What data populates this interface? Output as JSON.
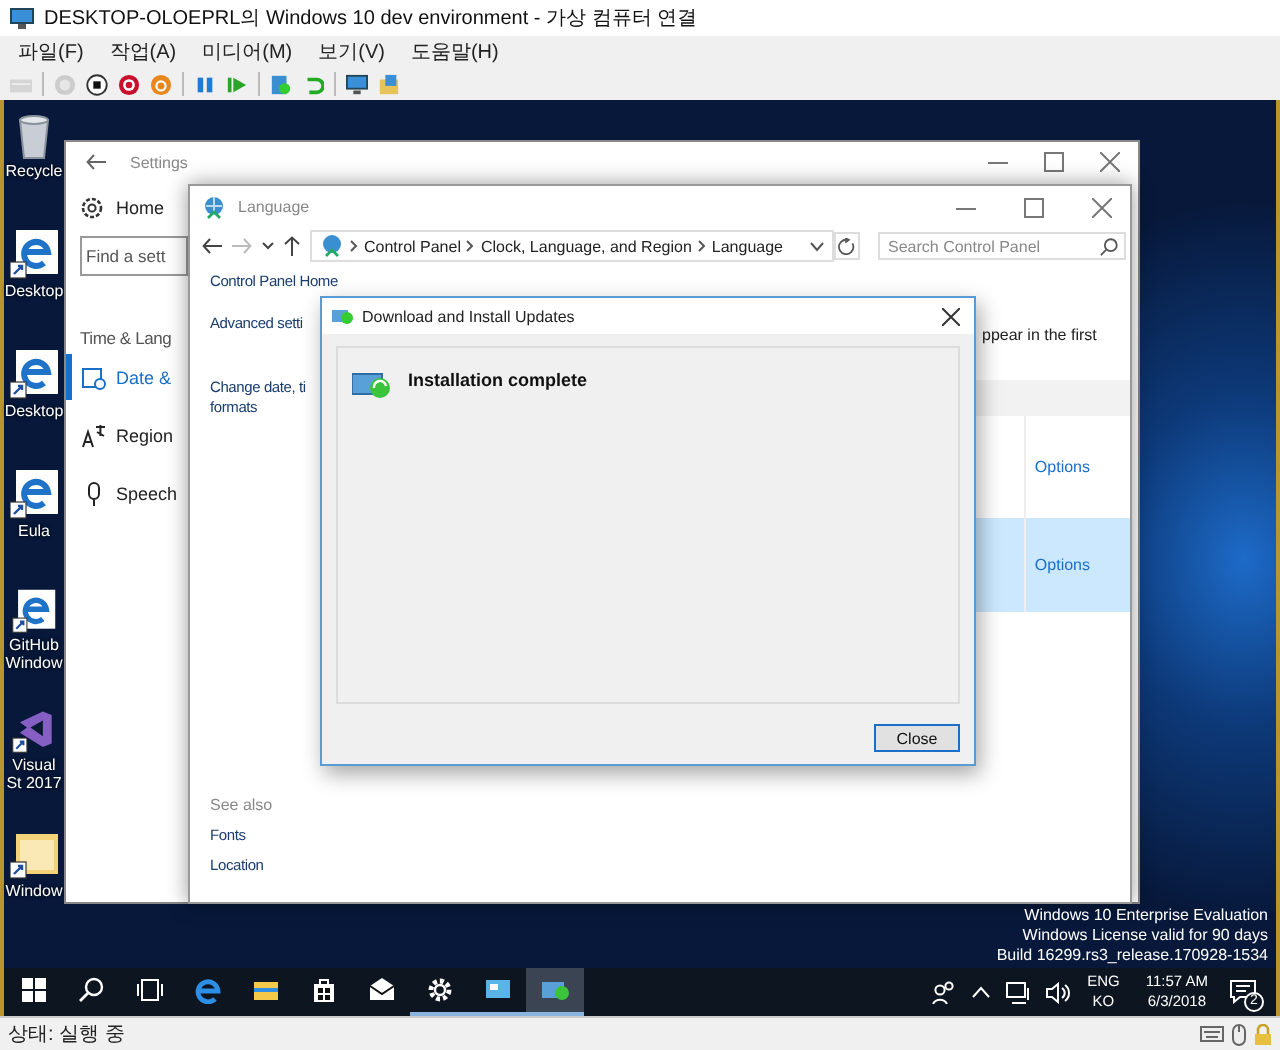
{
  "host_window": {
    "title": "DESKTOP-OLOEPRL의 Windows 10 dev environment - 가상 컴퓨터 연결",
    "menu": [
      "파일(F)",
      "작업(A)",
      "미디어(M)",
      "보기(V)",
      "도움말(H)"
    ],
    "toolbar_groups": [
      [
        {
          "kind": "ctrl-alt-del",
          "disabled": true
        }
      ],
      [
        {
          "kind": "start",
          "disabled": true
        },
        {
          "kind": "turn-off",
          "disabled": false
        },
        {
          "kind": "shut-down",
          "disabled": false
        },
        {
          "kind": "save",
          "disabled": false
        }
      ],
      [
        {
          "kind": "pause",
          "disabled": false
        },
        {
          "kind": "reset",
          "disabled": false
        }
      ],
      [
        {
          "kind": "checkpoint",
          "disabled": false
        },
        {
          "kind": "revert",
          "disabled": false
        }
      ],
      [
        {
          "kind": "session",
          "disabled": false
        },
        {
          "kind": "share",
          "disabled": false
        }
      ]
    ],
    "status": "상태: 실행 중"
  },
  "desktop_icons": [
    {
      "kind": "recycle",
      "label": "Recycle"
    },
    {
      "kind": "edge",
      "label": "Desktop"
    },
    {
      "kind": "edge",
      "label": "Desktop"
    },
    {
      "kind": "edge",
      "label": "Eula"
    },
    {
      "kind": "edge",
      "label": "GitHub Window"
    },
    {
      "kind": "vs",
      "label": "Visual St 2017"
    },
    {
      "kind": "folder",
      "label": "Window"
    }
  ],
  "settings_window": {
    "title": "Settings",
    "home": "Home",
    "search": {
      "placeholder": "Find a sett"
    },
    "section": "Time & Lang",
    "nav": [
      {
        "kind": "date",
        "label": "Date &",
        "selected": true
      },
      {
        "kind": "region",
        "label": "Region",
        "selected": false
      },
      {
        "kind": "speech",
        "label": "Speech",
        "selected": false
      }
    ]
  },
  "language_window": {
    "title": "Language",
    "breadcrumb": [
      "Control Panel",
      "Clock, Language, and Region",
      "Language"
    ],
    "search": {
      "placeholder": "Search Control Panel"
    },
    "side_links": [
      "Control Panel Home",
      "Advanced setti",
      "Change date, ti formats"
    ],
    "description": "ppear in the first",
    "rows": [
      {
        "link": "Options",
        "selected": false
      },
      {
        "link": "Options",
        "selected": true
      }
    ],
    "see_also": {
      "heading": "See also",
      "links": [
        "Fonts",
        "Location"
      ]
    }
  },
  "dialog": {
    "title": "Download and Install Updates",
    "message": "Installation complete",
    "button": "Close"
  },
  "watermark": [
    "Windows 10 Enterprise Evaluation",
    "Windows License valid for 90 days",
    "Build 16299.rs3_release.170928-1534"
  ],
  "taskbar": {
    "items": [
      {
        "kind": "start",
        "open": false,
        "selected": false
      },
      {
        "kind": "search",
        "open": false,
        "selected": false
      },
      {
        "kind": "task-view",
        "open": false,
        "selected": false
      },
      {
        "kind": "edge",
        "open": false,
        "selected": false
      },
      {
        "kind": "explorer",
        "open": false,
        "selected": false
      },
      {
        "kind": "store",
        "open": false,
        "selected": false
      },
      {
        "kind": "mail",
        "open": false,
        "selected": false
      },
      {
        "kind": "settings",
        "open": true,
        "selected": false
      },
      {
        "kind": "remote",
        "open": true,
        "selected": false
      },
      {
        "kind": "update",
        "open": true,
        "selected": true
      }
    ],
    "input_lang": [
      "ENG",
      "KO"
    ],
    "time": "11:57 AM",
    "date": "6/3/2018",
    "notifications": "2"
  }
}
